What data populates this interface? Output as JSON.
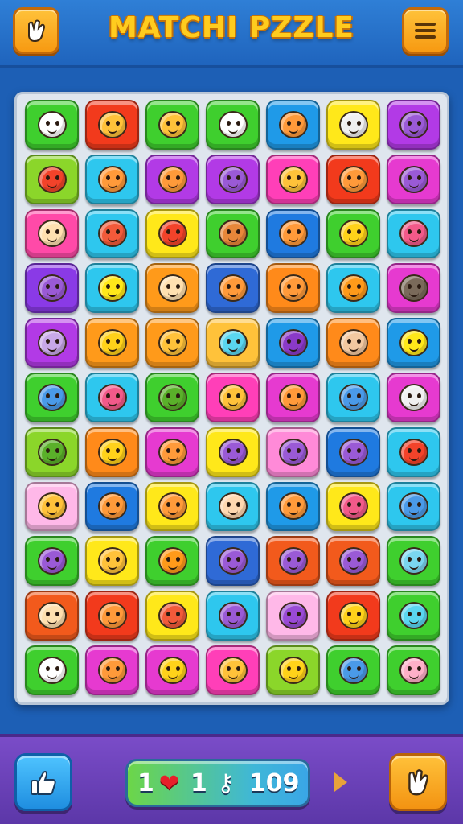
{
  "header": {
    "title": "MATCHI PZZLE",
    "left_button_icon": "hand-pointer-icon",
    "right_button_icon": "menu-icon"
  },
  "board": {
    "columns": 7,
    "rows": 11,
    "tiles": [
      [
        "#3fcf2e",
        "house-icon"
      ],
      [
        "#f23a1c",
        "smiley-icon"
      ],
      [
        "#3fcf2e",
        "smiley-icon"
      ],
      [
        "#3fcf2e",
        "house-icon"
      ],
      [
        "#1f9ae8",
        "cat-face-icon"
      ],
      [
        "#ffe81a",
        "diamond-icon"
      ],
      [
        "#b23ae6",
        "creature-icon"
      ],
      [
        "#8bd62a",
        "tomato-icon"
      ],
      [
        "#2ec7ee",
        "cat-face-icon"
      ],
      [
        "#b23ae6",
        "cat-face-icon"
      ],
      [
        "#b23ae6",
        "creature-icon"
      ],
      [
        "#ff3fb8",
        "smiley-icon"
      ],
      [
        "#f23a1c",
        "cat-face-icon"
      ],
      [
        "#e63ad0",
        "creature-icon"
      ],
      [
        "#ff4aa8",
        "bear-icon"
      ],
      [
        "#2ec7ee",
        "fish-icon"
      ],
      [
        "#ffe81a",
        "tomato-icon"
      ],
      [
        "#3fcf2e",
        "hotdog-icon"
      ],
      [
        "#1f7ae0",
        "cat-face-icon"
      ],
      [
        "#3fcf2e",
        "hook-icon"
      ],
      [
        "#2ec7ee",
        "brush-icon"
      ],
      [
        "#8a3ae6",
        "creature-icon"
      ],
      [
        "#2ec7ee",
        "banana-icon"
      ],
      [
        "#ff9a1a",
        "bear-icon"
      ],
      [
        "#2f6ad6",
        "cat-face-icon"
      ],
      [
        "#ff8a1a",
        "cat-face-icon"
      ],
      [
        "#2ec7ee",
        "pumpkin-icon"
      ],
      [
        "#e63ad0",
        "mole-icon"
      ],
      [
        "#b23ae6",
        "camera-icon"
      ],
      [
        "#ff9a1a",
        "lemon-icon"
      ],
      [
        "#ff9a1a",
        "smiley-icon"
      ],
      [
        "#ffc23a",
        "crayon-icon"
      ],
      [
        "#1f9ae8",
        "donut-icon"
      ],
      [
        "#ff8a1a",
        "box-icon"
      ],
      [
        "#1f9ae8",
        "sponge-icon"
      ],
      [
        "#3fcf2e",
        "pencil-icon"
      ],
      [
        "#2ec7ee",
        "crossed-pencils-icon"
      ],
      [
        "#3fcf2e",
        "apple-icon"
      ],
      [
        "#ff3fb8",
        "smiley-icon"
      ],
      [
        "#e63ad0",
        "cat-face-icon"
      ],
      [
        "#2ec7ee",
        "pencil-icon"
      ],
      [
        "#e63ad0",
        "diamond-icon"
      ],
      [
        "#8bd62a",
        "tree-icon"
      ],
      [
        "#ff8a1a",
        "lemon-icon"
      ],
      [
        "#e63ad0",
        "cat-face-icon"
      ],
      [
        "#ffe81a",
        "creature-icon"
      ],
      [
        "#ff8ad8",
        "creature-icon"
      ],
      [
        "#1f7ae0",
        "creature-icon"
      ],
      [
        "#2ec7ee",
        "tomato-icon"
      ],
      [
        "#ffb8e8",
        "smiley-icon"
      ],
      [
        "#1f7ae0",
        "cat-face-icon"
      ],
      [
        "#ffe81a",
        "cat-face-icon"
      ],
      [
        "#2ec7ee",
        "bird-icon"
      ],
      [
        "#1f9ae8",
        "cat-face-icon"
      ],
      [
        "#ffe81a",
        "crossed-pencils-icon"
      ],
      [
        "#2ec7ee",
        "pencil-icon"
      ],
      [
        "#3fcf2e",
        "creature-icon"
      ],
      [
        "#ffe81a",
        "smiley-icon"
      ],
      [
        "#3fcf2e",
        "pumpkin-icon"
      ],
      [
        "#2f6ad6",
        "creature-icon"
      ],
      [
        "#f25a1c",
        "creature-icon"
      ],
      [
        "#f25a1c",
        "creature-icon"
      ],
      [
        "#3fcf2e",
        "face-cap-icon"
      ],
      [
        "#f25a1c",
        "bear-icon"
      ],
      [
        "#f23a1c",
        "cat-face-icon"
      ],
      [
        "#ffe81a",
        "fish-icon"
      ],
      [
        "#2ec7ee",
        "creature-icon"
      ],
      [
        "#ffb8e8",
        "elephant-icon"
      ],
      [
        "#f23a1c",
        "sun-icon"
      ],
      [
        "#3fcf2e",
        "crayon-icon"
      ],
      [
        "#3fcf2e",
        "house-icon"
      ],
      [
        "#e63ad0",
        "cat-face-icon"
      ],
      [
        "#e63ad0",
        "lemon-icon"
      ],
      [
        "#ff3fb8",
        "smiley-icon"
      ],
      [
        "#8bd62a",
        "lemon-icon"
      ],
      [
        "#3fcf2e",
        "pencil-icon"
      ],
      [
        "#3fcf2e",
        "pig-icon"
      ]
    ]
  },
  "footer": {
    "like_icon": "thumbs-up-icon",
    "lives_value": "1",
    "heart_glyph": "❤",
    "keys_value": "1",
    "key_glyph": "⚷",
    "score_value": "109",
    "hint_icon": "hand-pointer-icon"
  }
}
